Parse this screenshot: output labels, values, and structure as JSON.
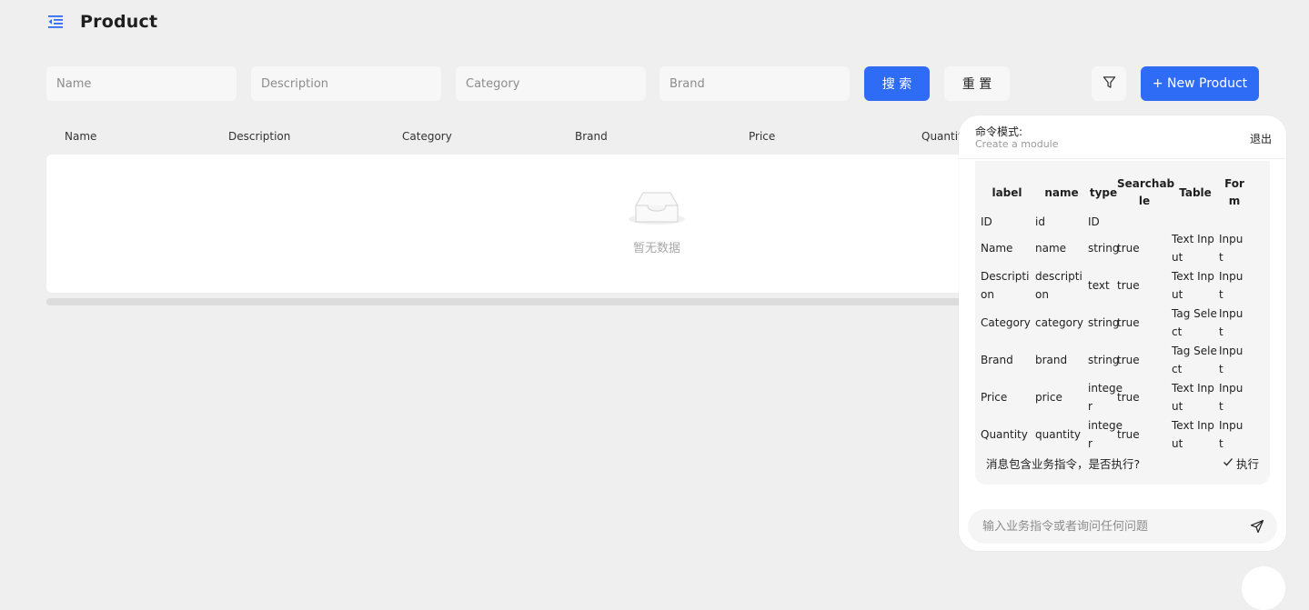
{
  "header": {
    "title": "Product",
    "menu_icon": "menu-fold-icon"
  },
  "search": {
    "name_placeholder": "Name",
    "description_placeholder": "Description",
    "category_placeholder": "Category",
    "brand_placeholder": "Brand",
    "search_label": "搜 索",
    "reset_label": "重 置",
    "filter_icon": "filter-icon",
    "new_label": "+ New Product"
  },
  "table": {
    "columns": [
      "Name",
      "Description",
      "Category",
      "Brand",
      "Price",
      "Quantit"
    ],
    "empty_text": "暂无数据"
  },
  "chat": {
    "mode_label": "命令模式:",
    "module_label": "Create a module",
    "exit_label": "退出",
    "headers": [
      [
        "label"
      ],
      [
        "name"
      ],
      [
        "type"
      ],
      [
        "Searchab",
        "le"
      ],
      [
        "Table"
      ],
      [
        "For",
        "m"
      ]
    ],
    "rows": [
      [
        [
          "ID"
        ],
        [
          "id"
        ],
        [
          "ID"
        ],
        [
          ""
        ],
        [
          ""
        ],
        [
          ""
        ]
      ],
      [
        [
          "Name"
        ],
        [
          "name"
        ],
        [
          "string"
        ],
        [
          "true"
        ],
        [
          "Text Inp",
          "ut"
        ],
        [
          "Inpu",
          "t"
        ]
      ],
      [
        [
          "Descripti",
          "on"
        ],
        [
          "descripti",
          "on"
        ],
        [
          "text"
        ],
        [
          "true"
        ],
        [
          "Text Inp",
          "ut"
        ],
        [
          "Inpu",
          "t"
        ]
      ],
      [
        [
          "Category"
        ],
        [
          "category"
        ],
        [
          "string"
        ],
        [
          "true"
        ],
        [
          "Tag Sele",
          "ct"
        ],
        [
          "Inpu",
          "t"
        ]
      ],
      [
        [
          "Brand"
        ],
        [
          "brand"
        ],
        [
          "string"
        ],
        [
          "true"
        ],
        [
          "Tag Sele",
          "ct"
        ],
        [
          "Inpu",
          "t"
        ]
      ],
      [
        [
          "Price"
        ],
        [
          "price"
        ],
        [
          "intege",
          "r"
        ],
        [
          "true"
        ],
        [
          "Text Inp",
          "ut"
        ],
        [
          "Inpu",
          "t"
        ]
      ],
      [
        [
          "Quantity"
        ],
        [
          "quantity"
        ],
        [
          "intege",
          "r"
        ],
        [
          "true"
        ],
        [
          "Text Inp",
          "ut"
        ],
        [
          "Inpu",
          "t"
        ]
      ]
    ],
    "confirm_text": "消息包含业务指令，是否执行?",
    "execute_label": "执行",
    "input_placeholder": "输入业务指令或者询问任何问题",
    "send_icon": "send-icon"
  },
  "colors": {
    "primary": "#2f6cf6",
    "background": "#efefef"
  }
}
